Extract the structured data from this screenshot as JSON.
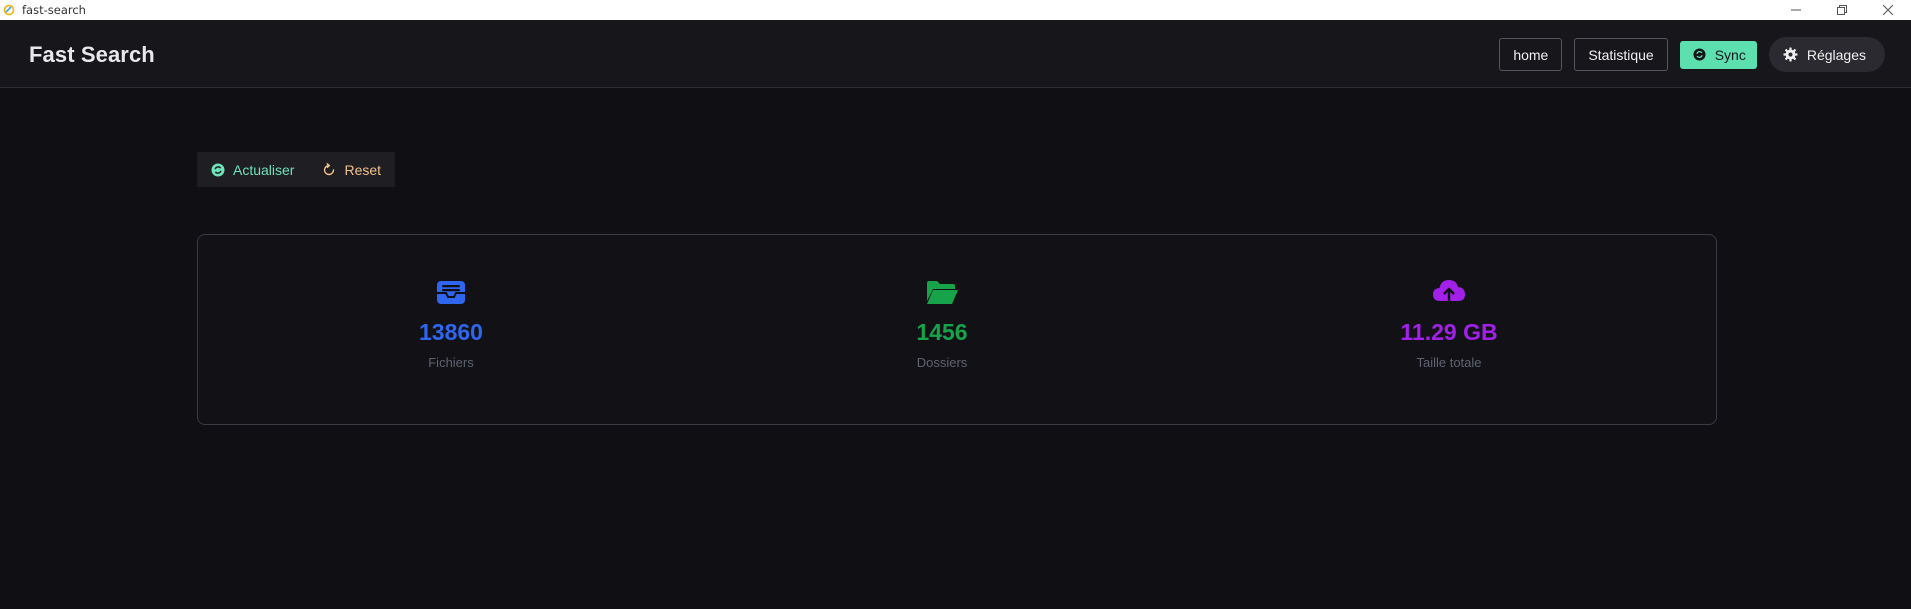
{
  "window": {
    "title": "fast-search",
    "app_icon": "app-logo-icon",
    "controls": [
      "minimize-icon",
      "restore-icon",
      "close-icon"
    ]
  },
  "header": {
    "title": "Fast Search",
    "nav": {
      "home_label": "home",
      "stats_label": "Statistique",
      "sync_label": "Sync",
      "settings_label": "Réglages"
    }
  },
  "toolbar": {
    "refresh_label": "Actualiser",
    "reset_label": "Reset"
  },
  "stats": {
    "files": {
      "value": "13860",
      "label": "Fichiers",
      "icon": "inbox-icon",
      "color": "#2f66f0"
    },
    "folders": {
      "value": "1456",
      "label": "Dossiers",
      "icon": "folder-open-icon",
      "color": "#16a34a"
    },
    "size": {
      "value": "11.29 GB",
      "label": "Taille totale",
      "icon": "cloud-upload-icon",
      "color": "#a220e8"
    }
  },
  "colors": {
    "background": "#0f0f14",
    "header_bg": "#16161b",
    "accent_green": "#5de0b0",
    "reset_orange": "#f1c28b"
  }
}
